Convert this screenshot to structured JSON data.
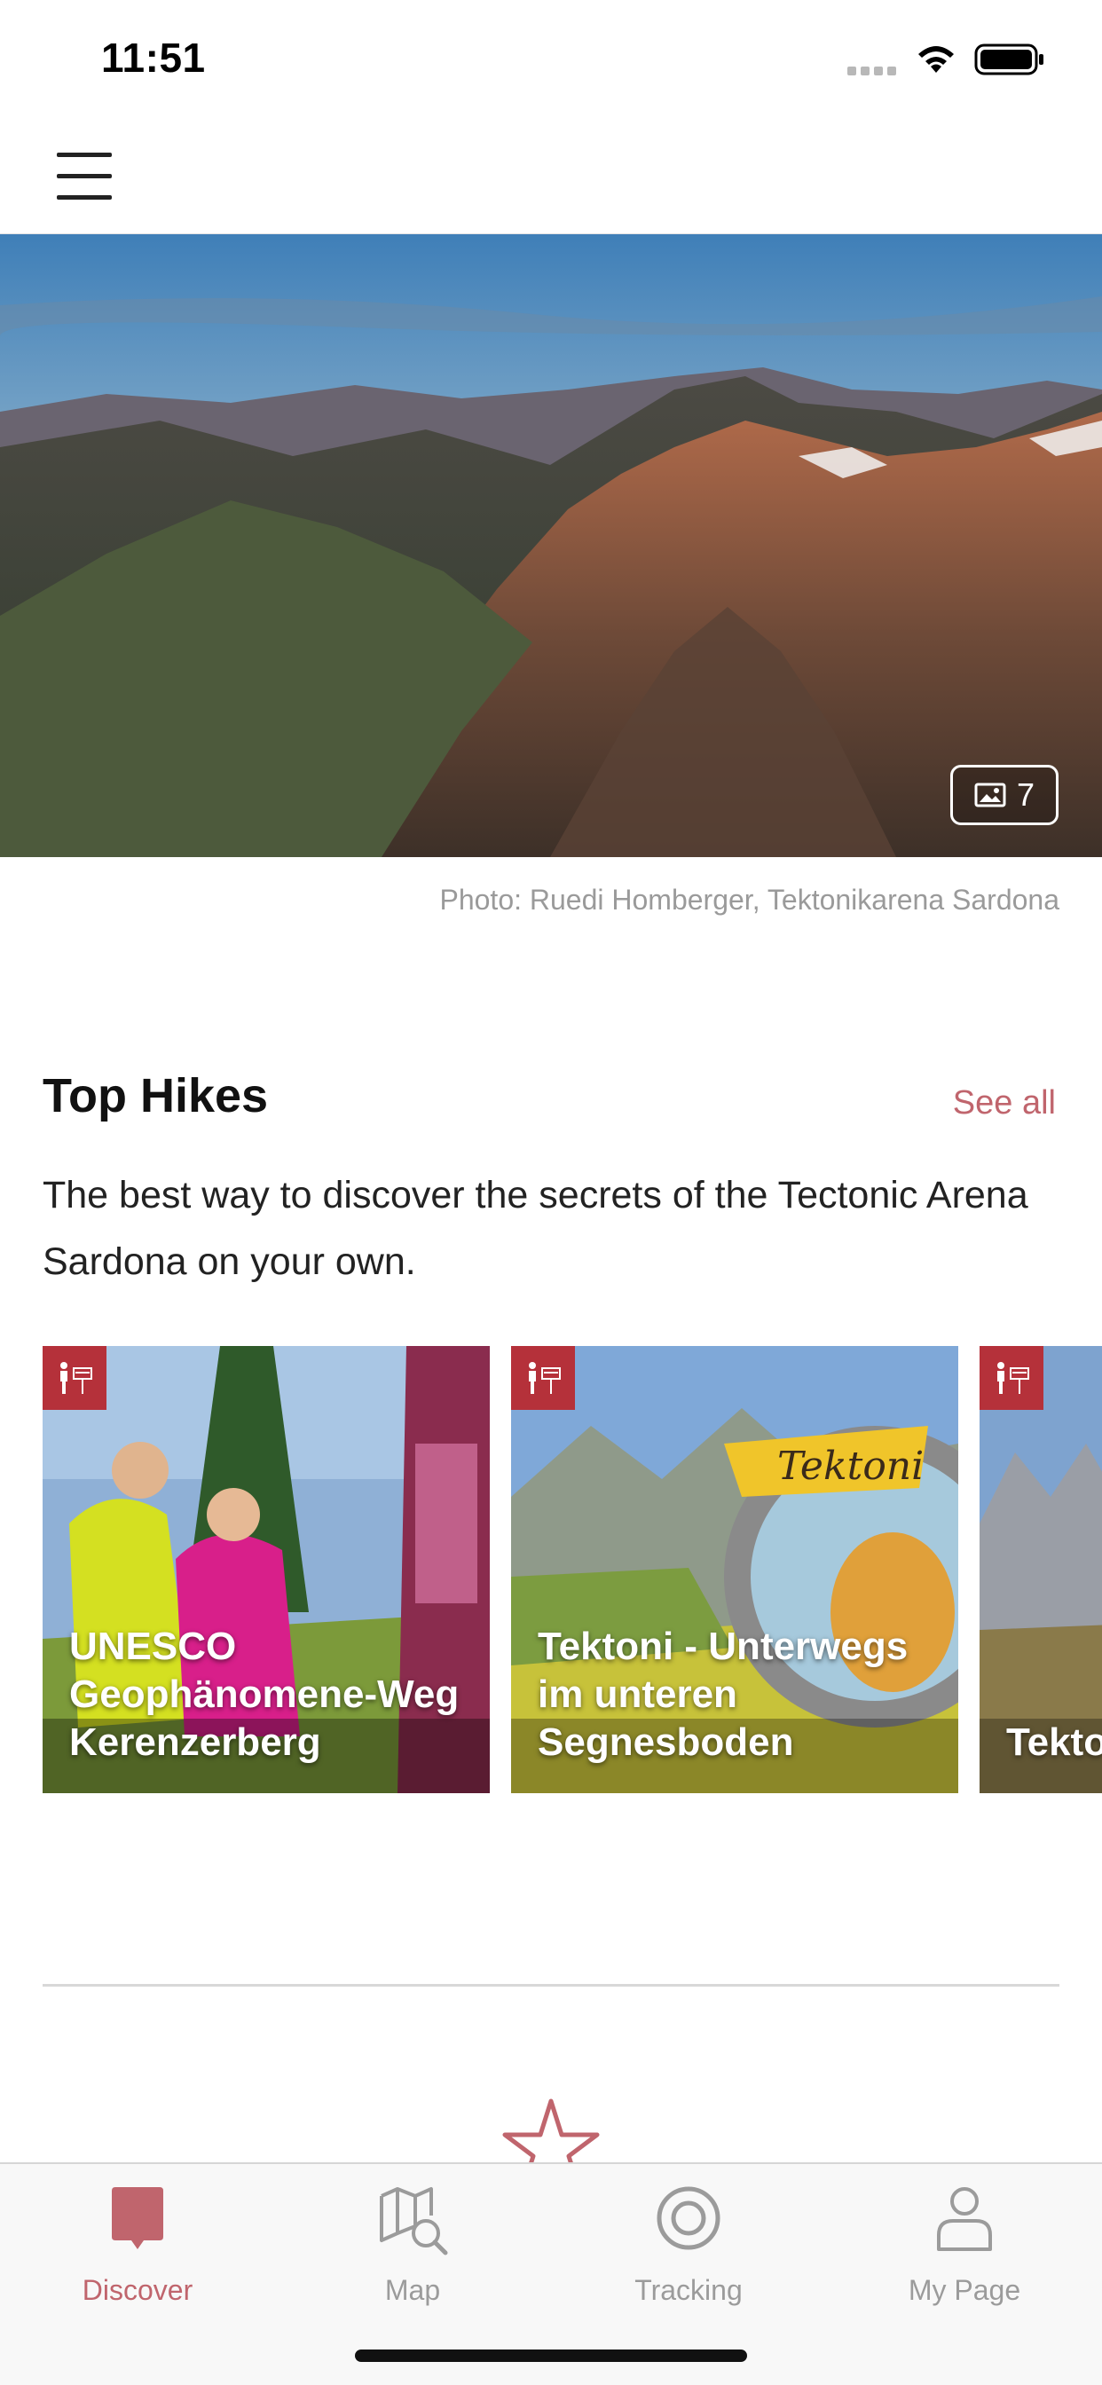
{
  "status_bar": {
    "time": "11:51"
  },
  "hero": {
    "gallery_count": "7",
    "photo_credit": "Photo: Ruedi Homberger, Tektonikarena Sardona"
  },
  "top_hikes": {
    "title": "Top Hikes",
    "see_all": "See all",
    "description": "The best way to discover the secrets of the Tectonic Arena Sardona on your own.",
    "cards": [
      {
        "title": "UNESCO Geophänomene-Weg Kerenzerberg",
        "icon": "hiking-icon"
      },
      {
        "title": "Tektoni - Unterwegs im unteren Segnesboden",
        "icon": "hiking-icon"
      },
      {
        "title": "Tektoni flight Martin",
        "icon": "hiking-icon"
      }
    ]
  },
  "tab_bar": {
    "tabs": [
      {
        "label": "Discover",
        "icon": "discover-icon",
        "active": true
      },
      {
        "label": "Map",
        "icon": "map-icon",
        "active": false
      },
      {
        "label": "Tracking",
        "icon": "tracking-icon",
        "active": false
      },
      {
        "label": "My Page",
        "icon": "profile-icon",
        "active": false
      }
    ]
  },
  "colors": {
    "accent": "#c0656d",
    "tag": "#b5313a",
    "inactive": "#9b9b9b"
  }
}
